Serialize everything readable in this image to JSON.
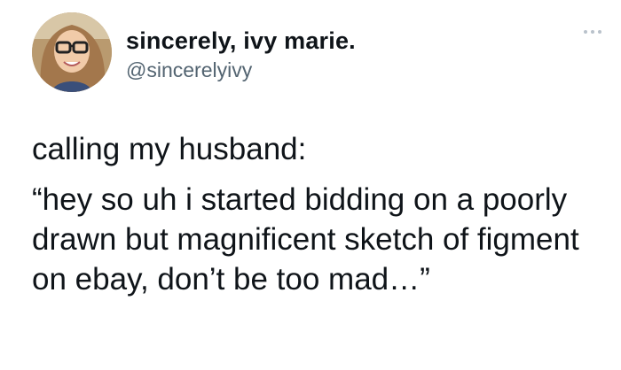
{
  "author": {
    "display_name": "sincerely, ivy marie.",
    "handle": "@sincerelyivy"
  },
  "icons": {
    "more": "more-options-icon",
    "avatar": "profile-photo"
  },
  "tweet": {
    "line1": "calling my husband:",
    "quote": "“hey so uh i started bidding on a poorly drawn but magnificent sketch of figment on ebay, don’t be too mad…”"
  },
  "colors": {
    "text": "#0f1419",
    "secondary": "#536471",
    "more_dots": "#b9c2cb"
  }
}
